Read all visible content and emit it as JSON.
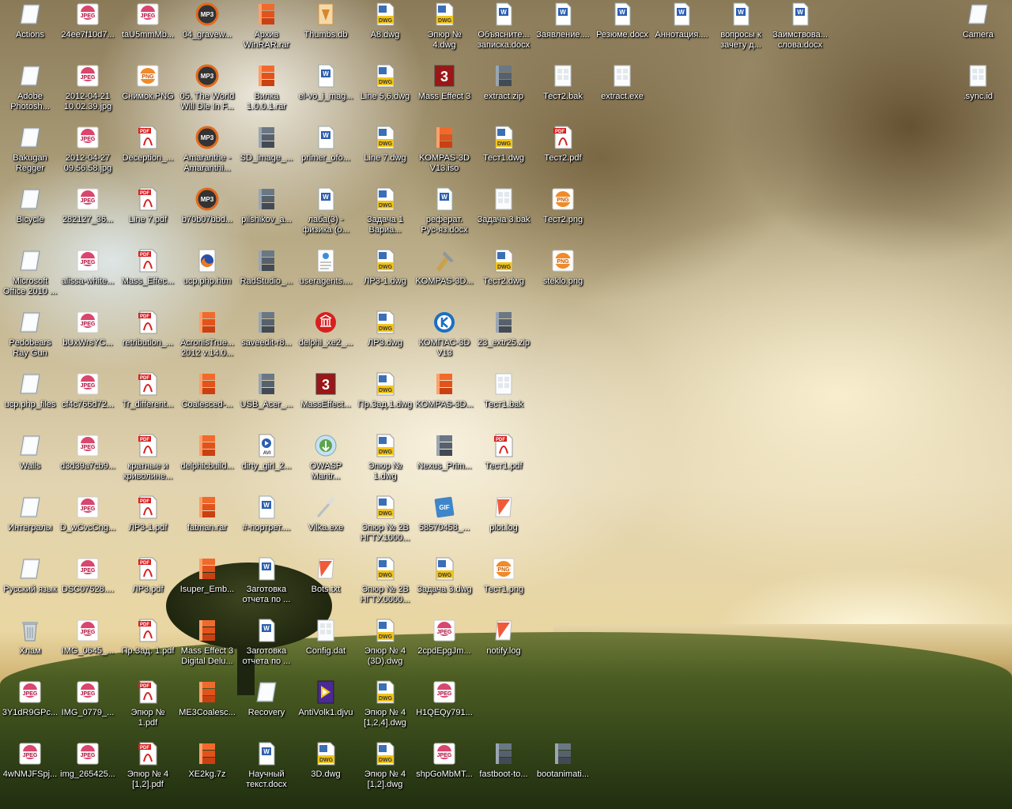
{
  "desktop": {
    "icons": [
      {
        "label": "Actions",
        "icon": "shortcut-icon",
        "col": 0,
        "row": 0
      },
      {
        "label": "24ee7f10d7...",
        "icon": "jpeg-icon",
        "col": 1,
        "row": 0
      },
      {
        "label": "taU5mmMb...",
        "icon": "jpeg-icon",
        "col": 2,
        "row": 0
      },
      {
        "label": "04_gravew...",
        "icon": "mp3-icon",
        "col": 3,
        "row": 0
      },
      {
        "label": "Архив\nWinRAR.rar",
        "icon": "rar-icon",
        "col": 4,
        "row": 0
      },
      {
        "label": "Thumbs.db",
        "icon": "db-icon",
        "col": 5,
        "row": 0
      },
      {
        "label": "A8.dwg",
        "icon": "dwg-icon",
        "col": 6,
        "row": 0
      },
      {
        "label": "Эпюр №\n4.dwg",
        "icon": "dwg-icon",
        "col": 7,
        "row": 0
      },
      {
        "label": "Объясните...\nзаписка.docx",
        "icon": "word-icon",
        "col": 8,
        "row": 0
      },
      {
        "label": "Заявление....",
        "icon": "word-icon",
        "col": 9,
        "row": 0
      },
      {
        "label": "Резюме.docx",
        "icon": "word-icon",
        "col": 10,
        "row": 0
      },
      {
        "label": "Аннотация....",
        "icon": "word-icon",
        "col": 11,
        "row": 0
      },
      {
        "label": "вопросы к\nзачету д...",
        "icon": "word-icon",
        "col": 12,
        "row": 0
      },
      {
        "label": "Заимствова...\nслова.docx",
        "icon": "word-icon",
        "col": 13,
        "row": 0
      },
      {
        "label": "Camera",
        "icon": "shortcut-icon",
        "col": 16,
        "row": 0
      },
      {
        "label": "Adobe\nPhotosh...",
        "icon": "shortcut-icon",
        "col": 0,
        "row": 1
      },
      {
        "label": "2012-04-21\n10.02.39.jpg",
        "icon": "jpeg-icon",
        "col": 1,
        "row": 1
      },
      {
        "label": "Снимок.PNG",
        "icon": "png-icon",
        "col": 2,
        "row": 1
      },
      {
        "label": "05. The World\nWill Die In F...",
        "icon": "mp3-icon",
        "col": 3,
        "row": 1
      },
      {
        "label": "Вилка\n1.0.0.1.rar",
        "icon": "rar-icon",
        "col": 4,
        "row": 1
      },
      {
        "label": "el-vo_i_mag...",
        "icon": "word-icon",
        "col": 5,
        "row": 1
      },
      {
        "label": "Line 5,6.dwg",
        "icon": "dwg-icon",
        "col": 6,
        "row": 1
      },
      {
        "label": "Mass Effect 3",
        "icon": "masseffect-icon",
        "col": 7,
        "row": 1
      },
      {
        "label": "extract.zip",
        "icon": "zip-icon",
        "col": 8,
        "row": 1
      },
      {
        "label": "Тест2.bak",
        "icon": "generic-file-icon",
        "col": 9,
        "row": 1
      },
      {
        "label": "extract.exe",
        "icon": "generic-file-icon",
        "col": 10,
        "row": 1
      },
      {
        "label": ".sync.id",
        "icon": "generic-file-icon",
        "col": 16,
        "row": 1
      },
      {
        "label": "Bakugan\nRegger",
        "icon": "shortcut-icon",
        "col": 0,
        "row": 2
      },
      {
        "label": "2012-04-27\n09.56.58.jpg",
        "icon": "jpeg-icon",
        "col": 1,
        "row": 2
      },
      {
        "label": "Deception_...",
        "icon": "pdf-icon",
        "col": 2,
        "row": 2
      },
      {
        "label": "Amaranthe -\nAmaranthi...",
        "icon": "mp3-icon",
        "col": 3,
        "row": 2
      },
      {
        "label": "SD_image_...",
        "icon": "zip-icon",
        "col": 4,
        "row": 2
      },
      {
        "label": "primer_ofo...",
        "icon": "word-icon",
        "col": 5,
        "row": 2
      },
      {
        "label": "Line 7.dwg",
        "icon": "dwg-icon",
        "col": 6,
        "row": 2
      },
      {
        "label": "KOMPAS-3D\nV13.iso",
        "icon": "rar-icon",
        "col": 7,
        "row": 2
      },
      {
        "label": "Тест1.dwg",
        "icon": "dwg-icon",
        "col": 8,
        "row": 2
      },
      {
        "label": "Тест2.pdf",
        "icon": "pdf-icon",
        "col": 9,
        "row": 2
      },
      {
        "label": "Bicycle",
        "icon": "shortcut-icon",
        "col": 0,
        "row": 3
      },
      {
        "label": "282127_36...",
        "icon": "jpeg-icon",
        "col": 1,
        "row": 3
      },
      {
        "label": "Line 7.pdf",
        "icon": "pdf-icon",
        "col": 2,
        "row": 3
      },
      {
        "label": "b70b07bbd...",
        "icon": "mp3-icon",
        "col": 3,
        "row": 3
      },
      {
        "label": "pilshikov_a...",
        "icon": "zip-icon",
        "col": 4,
        "row": 3
      },
      {
        "label": "лаба(3) -\nфизика (о...",
        "icon": "word-icon",
        "col": 5,
        "row": 3
      },
      {
        "label": "Задача 1\nВариа...",
        "icon": "dwg-icon",
        "col": 6,
        "row": 3
      },
      {
        "label": "реферат.\nРус-яз.docx",
        "icon": "word-icon",
        "col": 7,
        "row": 3
      },
      {
        "label": "Задача 3.bak",
        "icon": "generic-file-icon",
        "col": 8,
        "row": 3
      },
      {
        "label": "Тест2.png",
        "icon": "png-icon",
        "col": 9,
        "row": 3
      },
      {
        "label": "Microsoft\nOffice 2010 ...",
        "icon": "shortcut-icon",
        "col": 0,
        "row": 4
      },
      {
        "label": "alissa-white...",
        "icon": "jpeg-icon",
        "col": 1,
        "row": 4
      },
      {
        "label": "Mass_Effec...",
        "icon": "pdf-icon",
        "col": 2,
        "row": 4
      },
      {
        "label": "ucp.php.htm",
        "icon": "firefox-icon",
        "col": 3,
        "row": 4
      },
      {
        "label": "RadStudio_...",
        "icon": "zip-icon",
        "col": 4,
        "row": 4
      },
      {
        "label": "useragents....",
        "icon": "web-icon",
        "col": 5,
        "row": 4
      },
      {
        "label": "ЛР3-1.dwg",
        "icon": "dwg-icon",
        "col": 6,
        "row": 4
      },
      {
        "label": "KOMPAS-3D...",
        "icon": "tools-icon",
        "col": 7,
        "row": 4
      },
      {
        "label": "Тест2.dwg",
        "icon": "dwg-icon",
        "col": 8,
        "row": 4
      },
      {
        "label": "steklo.png",
        "icon": "png-icon",
        "col": 9,
        "row": 4
      },
      {
        "label": "Pedobears\nRay Gun",
        "icon": "shortcut-icon",
        "col": 0,
        "row": 5
      },
      {
        "label": "bUxWrsYC...",
        "icon": "jpeg-icon",
        "col": 1,
        "row": 5
      },
      {
        "label": "retribution_...",
        "icon": "pdf-icon",
        "col": 2,
        "row": 5
      },
      {
        "label": "AcronisTrue...\n2012 v.14.0...",
        "icon": "rar-icon",
        "col": 3,
        "row": 5
      },
      {
        "label": "saveedit-r8...",
        "icon": "zip-icon",
        "col": 4,
        "row": 5
      },
      {
        "label": "delphi_xe2_...",
        "icon": "delphi-icon",
        "col": 5,
        "row": 5
      },
      {
        "label": "ЛР3.dwg",
        "icon": "dwg-icon",
        "col": 6,
        "row": 5
      },
      {
        "label": "КОМПАС-3D\nV13",
        "icon": "kompas-icon",
        "col": 7,
        "row": 5
      },
      {
        "label": "23_extr25.zip",
        "icon": "zip-icon",
        "col": 8,
        "row": 5
      },
      {
        "label": "ucp.php_files",
        "icon": "shortcut-icon",
        "col": 0,
        "row": 6
      },
      {
        "label": "cf4c766d72...",
        "icon": "jpeg-icon",
        "col": 1,
        "row": 6
      },
      {
        "label": "Tr_different...",
        "icon": "pdf-icon",
        "col": 2,
        "row": 6
      },
      {
        "label": "Coalesced-...",
        "icon": "rar-icon",
        "col": 3,
        "row": 6
      },
      {
        "label": "USB_Acer_...",
        "icon": "zip-icon",
        "col": 4,
        "row": 6
      },
      {
        "label": "MassEffect...",
        "icon": "masseffect-icon",
        "col": 5,
        "row": 6
      },
      {
        "label": "Пр.Зад.1.dwg",
        "icon": "dwg-icon",
        "col": 6,
        "row": 6
      },
      {
        "label": "KOMPAS-3D...",
        "icon": "rar-icon",
        "col": 7,
        "row": 6
      },
      {
        "label": "Тест1.bak",
        "icon": "generic-file-icon",
        "col": 8,
        "row": 6
      },
      {
        "label": "Walls",
        "icon": "shortcut-icon",
        "col": 0,
        "row": 7
      },
      {
        "label": "d3d39a7cb9...",
        "icon": "jpeg-icon",
        "col": 1,
        "row": 7
      },
      {
        "label": "кратные и\nкриволине...",
        "icon": "pdf-icon",
        "col": 2,
        "row": 7
      },
      {
        "label": "delphicbuild...",
        "icon": "rar-icon",
        "col": 3,
        "row": 7
      },
      {
        "label": "dirty_girl_2...",
        "icon": "avi-icon",
        "col": 4,
        "row": 7
      },
      {
        "label": "OWASP\nMantr...",
        "icon": "owasp-icon",
        "col": 5,
        "row": 7
      },
      {
        "label": "Эпюр №\n1.dwg",
        "icon": "dwg-icon",
        "col": 6,
        "row": 7
      },
      {
        "label": "Nexus_Prim...",
        "icon": "zip-icon",
        "col": 7,
        "row": 7
      },
      {
        "label": "Тест1.pdf",
        "icon": "pdf-icon",
        "col": 8,
        "row": 7
      },
      {
        "label": "Интегралы",
        "icon": "shortcut-icon",
        "col": 0,
        "row": 8
      },
      {
        "label": "D_wCvcCng...",
        "icon": "jpeg-icon",
        "col": 1,
        "row": 8
      },
      {
        "label": "ЛР3-1.pdf",
        "icon": "pdf-icon",
        "col": 2,
        "row": 8
      },
      {
        "label": "fatman.rar",
        "icon": "rar-icon",
        "col": 3,
        "row": 8
      },
      {
        "label": "#-портрет....",
        "icon": "word-icon",
        "col": 4,
        "row": 8
      },
      {
        "label": "Vilka.exe",
        "icon": "fork-icon",
        "col": 5,
        "row": 8
      },
      {
        "label": "Эпюр № 2B\nНГТУ.1000...",
        "icon": "dwg-icon",
        "col": 6,
        "row": 8
      },
      {
        "label": "58570458_...",
        "icon": "gif-icon",
        "col": 7,
        "row": 8
      },
      {
        "label": "plot.log",
        "icon": "log-icon",
        "col": 8,
        "row": 8
      },
      {
        "label": "Русский язык",
        "icon": "shortcut-icon",
        "col": 0,
        "row": 9
      },
      {
        "label": "DSC07528....",
        "icon": "jpeg-icon",
        "col": 1,
        "row": 9
      },
      {
        "label": "ЛР3.pdf",
        "icon": "pdf-icon",
        "col": 2,
        "row": 9
      },
      {
        "label": "Isuper_Emb...",
        "icon": "rar-icon",
        "col": 3,
        "row": 9
      },
      {
        "label": "Заготовка\nотчета по ...",
        "icon": "word-icon",
        "col": 4,
        "row": 9
      },
      {
        "label": "Bots.txt",
        "icon": "log-icon",
        "col": 5,
        "row": 9
      },
      {
        "label": "Эпюр № 2B\nНГТУ.0000...",
        "icon": "dwg-icon",
        "col": 6,
        "row": 9
      },
      {
        "label": "Задача 3.dwg",
        "icon": "dwg-icon",
        "col": 7,
        "row": 9
      },
      {
        "label": "Тест1.png",
        "icon": "png-icon",
        "col": 8,
        "row": 9
      },
      {
        "label": "Хлам",
        "icon": "recycle-bin-icon",
        "col": 0,
        "row": 10
      },
      {
        "label": "IMG_0645_...",
        "icon": "jpeg-icon",
        "col": 1,
        "row": 10
      },
      {
        "label": "Пр.Зад. 1.pdf",
        "icon": "pdf-icon",
        "col": 2,
        "row": 10
      },
      {
        "label": "Mass Effect 3\nDigital Delu...",
        "icon": "rar-icon",
        "col": 3,
        "row": 10
      },
      {
        "label": "Заготовка\nотчета по ...",
        "icon": "word-icon",
        "col": 4,
        "row": 10
      },
      {
        "label": "Config.dat",
        "icon": "generic-file-icon",
        "col": 5,
        "row": 10
      },
      {
        "label": "Эпюр № 4\n(3D).dwg",
        "icon": "dwg-icon",
        "col": 6,
        "row": 10
      },
      {
        "label": "2cpdEpgJm...",
        "icon": "jpeg-icon",
        "col": 7,
        "row": 10
      },
      {
        "label": "notify.log",
        "icon": "log-icon",
        "col": 8,
        "row": 10
      },
      {
        "label": "3Y1dR9GPc...",
        "icon": "jpeg-icon",
        "col": 0,
        "row": 11
      },
      {
        "label": "IMG_0779_...",
        "icon": "jpeg-icon",
        "col": 1,
        "row": 11
      },
      {
        "label": "Эпюр №\n1.pdf",
        "icon": "pdf-icon",
        "col": 2,
        "row": 11
      },
      {
        "label": "ME3Coalesc...",
        "icon": "rar-icon",
        "col": 3,
        "row": 11
      },
      {
        "label": "Recovery",
        "icon": "shortcut-icon",
        "col": 4,
        "row": 11
      },
      {
        "label": "AntiVolk1.djvu",
        "icon": "djvu-icon",
        "col": 5,
        "row": 11
      },
      {
        "label": "Эпюр № 4\n[1,2,4].dwg",
        "icon": "dwg-icon",
        "col": 6,
        "row": 11
      },
      {
        "label": "H1QEQy791...",
        "icon": "jpeg-icon",
        "col": 7,
        "row": 11
      },
      {
        "label": "4wNMJFSpj...",
        "icon": "jpeg-icon",
        "col": 0,
        "row": 12
      },
      {
        "label": "img_265425...",
        "icon": "jpeg-icon",
        "col": 1,
        "row": 12
      },
      {
        "label": "Эпюр № 4\n[1,2].pdf",
        "icon": "pdf-icon",
        "col": 2,
        "row": 12
      },
      {
        "label": "XE2kg.7z",
        "icon": "rar-icon",
        "col": 3,
        "row": 12
      },
      {
        "label": "Научный\nтекст.docx",
        "icon": "word-icon",
        "col": 4,
        "row": 12
      },
      {
        "label": "3D.dwg",
        "icon": "dwg-icon",
        "col": 5,
        "row": 12
      },
      {
        "label": "Эпюр № 4\n[1,2].dwg",
        "icon": "dwg-icon",
        "col": 6,
        "row": 12
      },
      {
        "label": "shpGoMbMT...",
        "icon": "jpeg-icon",
        "col": 7,
        "row": 12
      },
      {
        "label": "fastboot-to...",
        "icon": "zip-icon",
        "col": 8,
        "row": 12
      },
      {
        "label": "bootanimati...",
        "icon": "zip-icon",
        "col": 9,
        "row": 12
      }
    ]
  }
}
